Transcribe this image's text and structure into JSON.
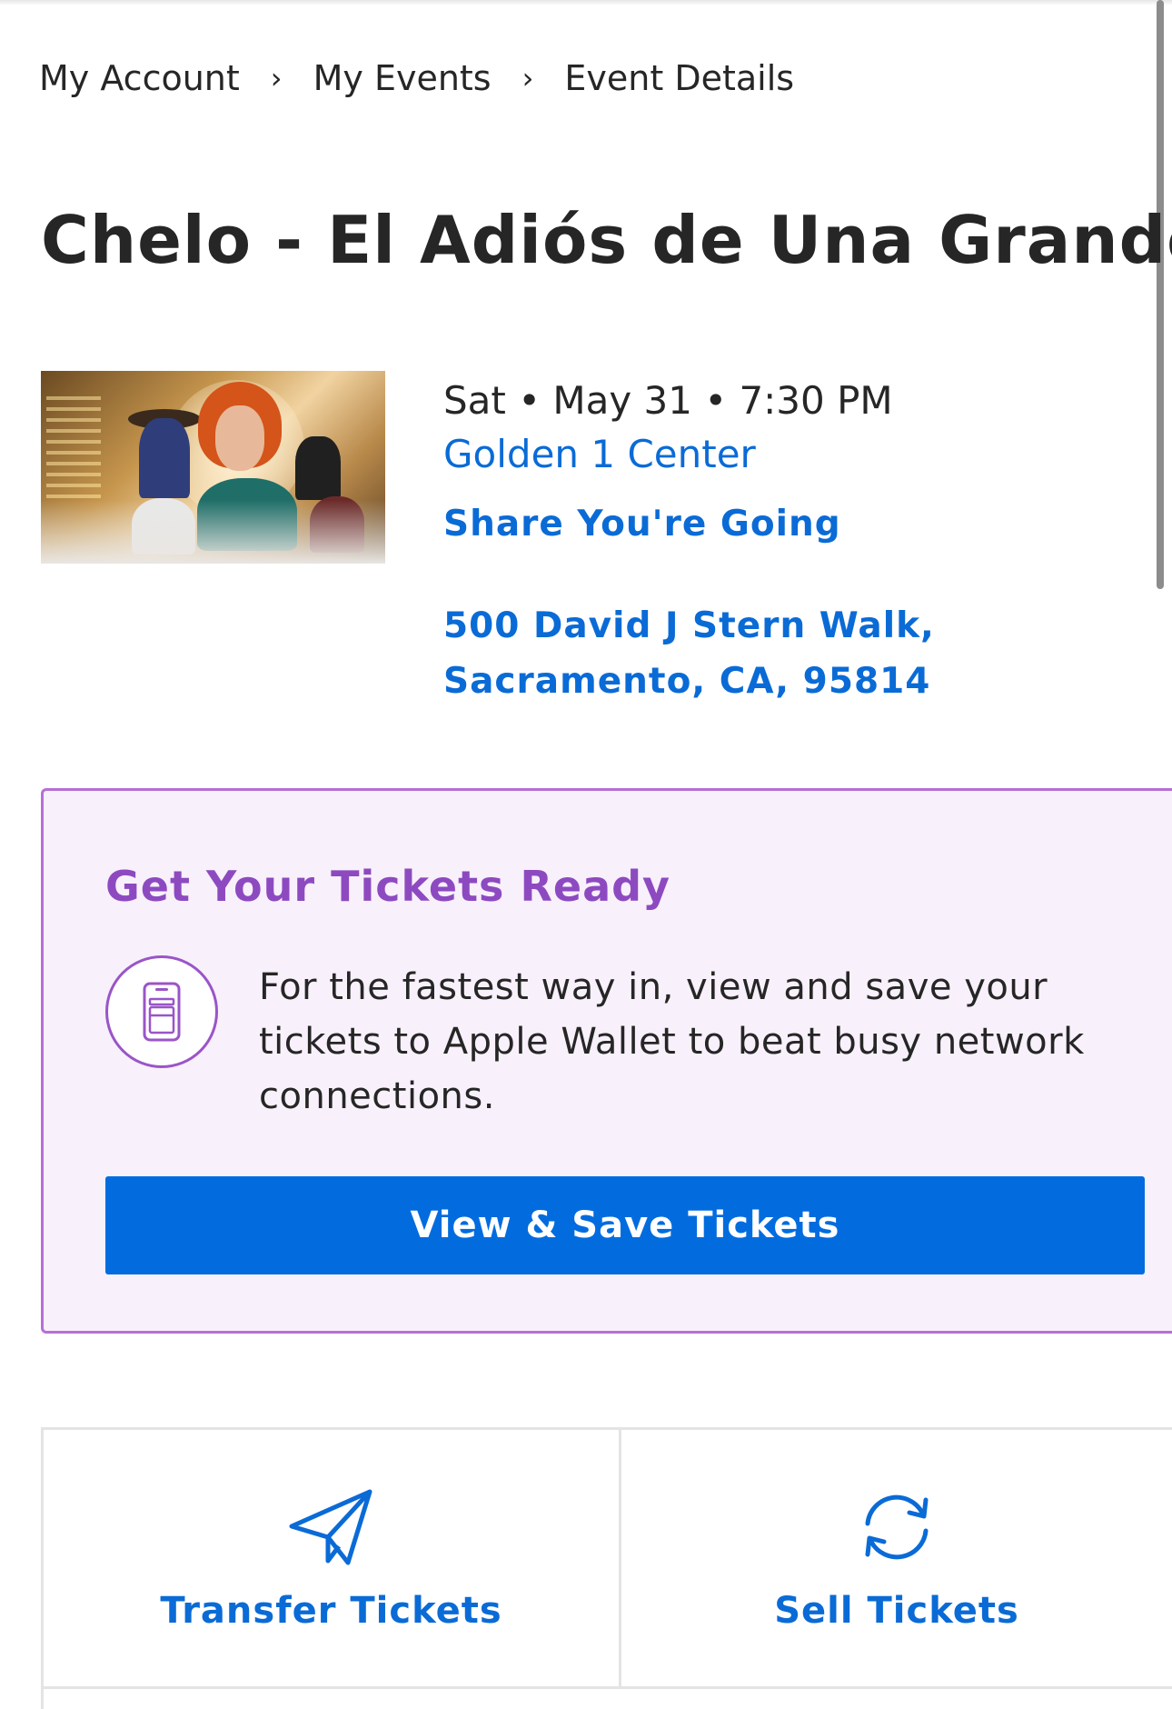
{
  "breadcrumb": {
    "items": [
      "My Account",
      "My Events",
      "Event Details"
    ],
    "separator": "›"
  },
  "event": {
    "title": "Chelo - El Adiós de Una Grande",
    "image_alt": "event-poster",
    "datetime": "Sat • May 31 • 7:30 PM",
    "venue": "Golden 1 Center",
    "share_label": "Share You're Going",
    "address": "500 David J Stern Walk, Sacramento, CA, 95814"
  },
  "tickets_card": {
    "heading": "Get Your Tickets Ready",
    "body": "For the fastest way in, view and save your tickets to Apple Wallet to beat busy network connections.",
    "button_label": "View & Save Tickets",
    "icon": "wallet-phone-icon"
  },
  "actions": {
    "transfer": {
      "label": "Transfer Tickets",
      "icon": "paper-plane-icon"
    },
    "sell": {
      "label": "Sell Tickets",
      "icon": "sync-arrows-icon"
    }
  },
  "colors": {
    "link_blue": "#0a6bd6",
    "button_blue": "#026cdf",
    "card_purple_border": "#b66fd5",
    "card_heading_purple": "#8d4ac0",
    "card_background": "#f8f0fb"
  }
}
